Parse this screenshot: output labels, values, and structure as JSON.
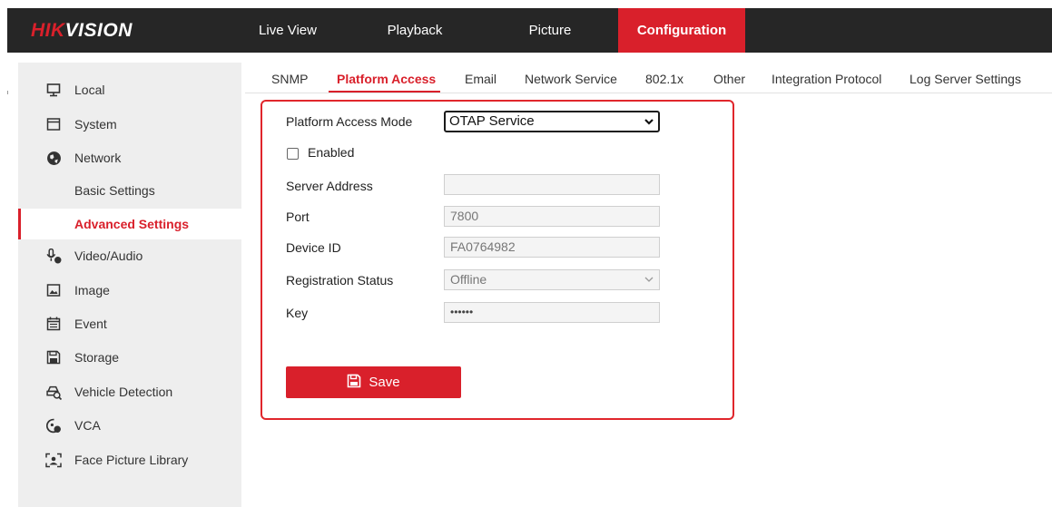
{
  "header": {
    "logo_red": "HIK",
    "logo_white": "VISION",
    "nav": [
      {
        "label": "Live View"
      },
      {
        "label": "Playback"
      },
      {
        "label": "Picture"
      },
      {
        "label": "Configuration",
        "active": true
      }
    ]
  },
  "sidebar": {
    "items": [
      {
        "label": "Local",
        "icon": "monitor-icon"
      },
      {
        "label": "System",
        "icon": "system-icon"
      },
      {
        "label": "Network",
        "icon": "globe-icon"
      },
      {
        "label": "Basic Settings"
      },
      {
        "label": "Advanced Settings",
        "active": true
      },
      {
        "label": "Video/Audio",
        "icon": "video-audio-icon"
      },
      {
        "label": "Image",
        "icon": "image-icon"
      },
      {
        "label": "Event",
        "icon": "calendar-icon"
      },
      {
        "label": "Storage",
        "icon": "floppy-icon"
      },
      {
        "label": "Vehicle Detection",
        "icon": "vehicle-icon"
      },
      {
        "label": "VCA",
        "icon": "vca-icon"
      },
      {
        "label": "Face Picture Library",
        "icon": "face-icon"
      }
    ]
  },
  "tabs": [
    {
      "label": "SNMP"
    },
    {
      "label": "Platform Access",
      "active": true
    },
    {
      "label": "Email"
    },
    {
      "label": "Network Service"
    },
    {
      "label": "802.1x"
    },
    {
      "label": "Other"
    },
    {
      "label": "Integration Protocol"
    },
    {
      "label": "Log Server Settings"
    }
  ],
  "form": {
    "mode_label": "Platform Access Mode",
    "mode_value": "OTAP Service",
    "enabled_label": "Enabled",
    "enabled_checked": false,
    "server_label": "Server Address",
    "server_value": "",
    "port_label": "Port",
    "port_value": "7800",
    "device_label": "Device ID",
    "device_value": "FA0764982",
    "status_label": "Registration Status",
    "status_value": "Offline",
    "key_label": "Key",
    "key_value": "••••••",
    "save_label": "Save"
  },
  "colors": {
    "accent": "#d9202b",
    "topbar": "#262626",
    "highlight": "#e0262c"
  }
}
